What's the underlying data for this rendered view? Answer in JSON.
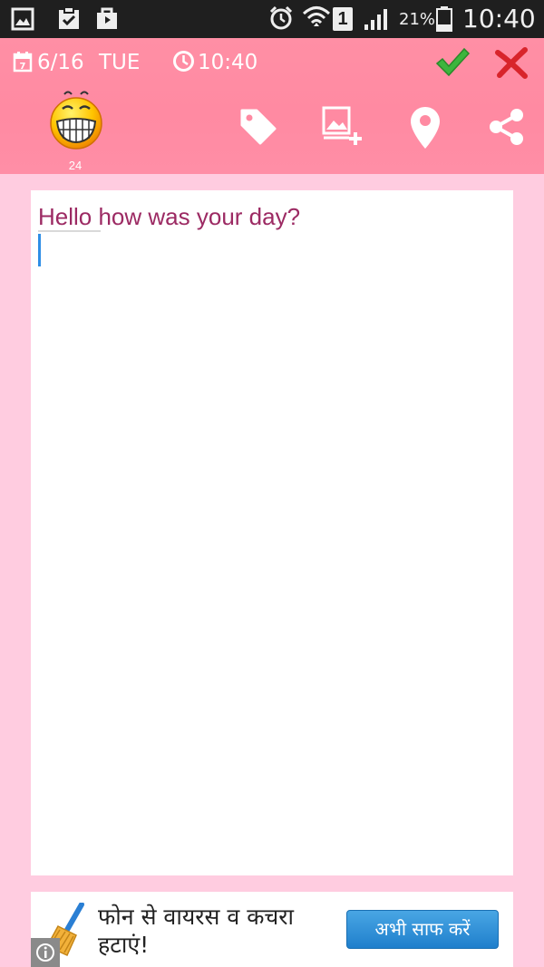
{
  "status_bar": {
    "battery_percent": "21%",
    "time": "10:40",
    "sim_slot": "1",
    "icons": [
      "gallery-icon",
      "clipboard-check-icon",
      "shopping-bag-icon",
      "alarm-icon",
      "wifi-icon",
      "sim-icon",
      "signal-icon",
      "battery-icon"
    ]
  },
  "header": {
    "date": "6/16",
    "weekday": "TUE",
    "time": "10:40",
    "mood_count": "24",
    "icons": [
      "calendar-icon",
      "clock-icon",
      "save-check-icon",
      "discard-x-icon",
      "grinning-emoji-icon",
      "tag-icon",
      "add-image-icon",
      "location-pin-icon",
      "share-icon"
    ],
    "colors": {
      "header_bg": "#ff8aa2",
      "page_bg": "#ffcce0"
    }
  },
  "editor": {
    "text": "Hello how was your day?",
    "text_color": "#9c2a63",
    "cursor_color": "#2f8ee6"
  },
  "ad": {
    "message": "फोन से वायरस व कचरा हटाएं!",
    "button_label": "अभी साफ करें",
    "icons": [
      "broom-icon",
      "info-icon"
    ]
  }
}
